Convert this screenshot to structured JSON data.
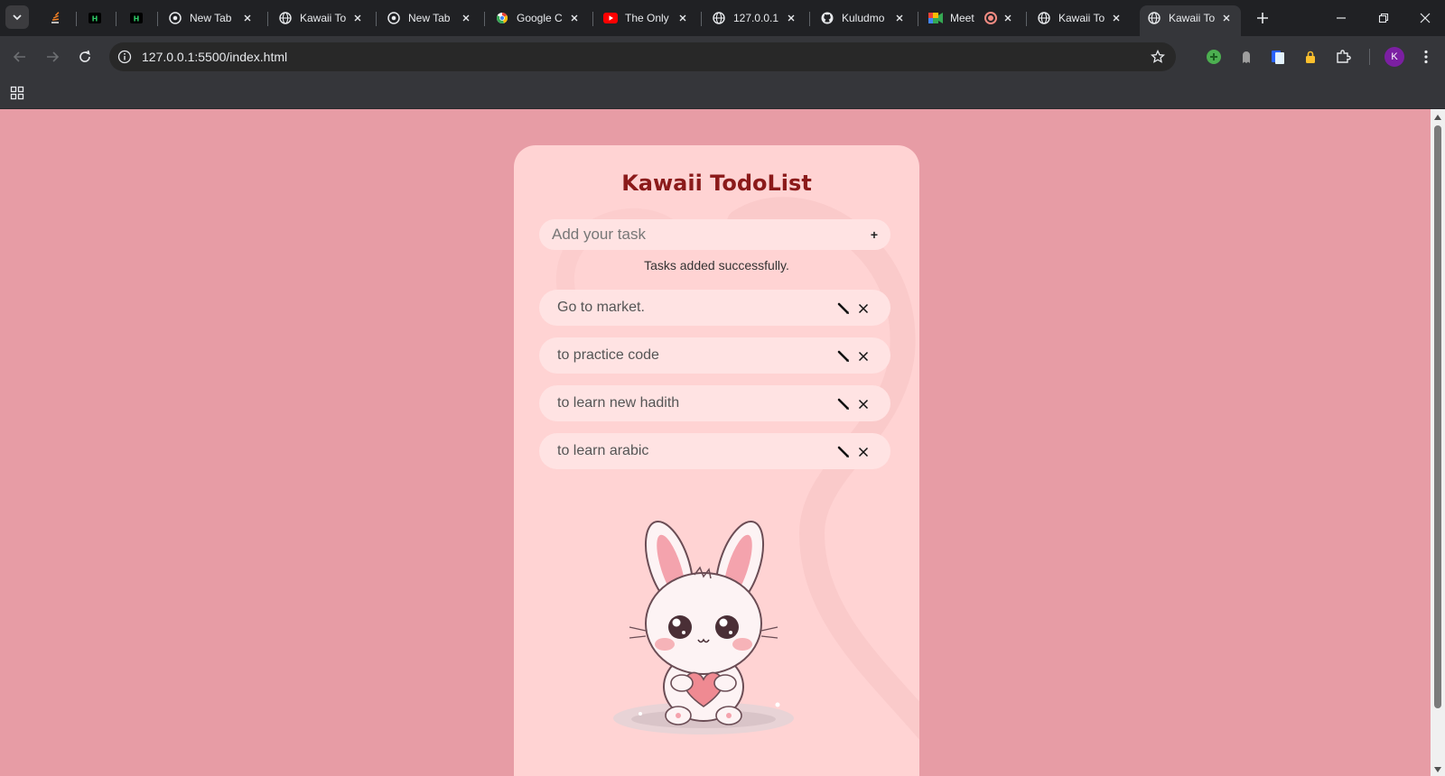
{
  "browser": {
    "tabs": [
      {
        "title": "",
        "favicon": "tab-list-icon"
      },
      {
        "title": "",
        "favicon": "stackoverflow-icon"
      },
      {
        "title": "",
        "favicon": "hackerrank-icon"
      },
      {
        "title": "",
        "favicon": "hackerrank-icon"
      },
      {
        "title": "New Tab",
        "favicon": "chrome-icon"
      },
      {
        "title": "Kawaii To",
        "favicon": "globe-icon"
      },
      {
        "title": "New Tab",
        "favicon": "chrome-icon"
      },
      {
        "title": "Google C",
        "favicon": "google-icon"
      },
      {
        "title": "The Only",
        "favicon": "youtube-icon"
      },
      {
        "title": "127.0.0.1",
        "favicon": "globe-icon"
      },
      {
        "title": "Kuludmo",
        "favicon": "github-icon"
      },
      {
        "title": "Meet",
        "favicon": "meet-icon"
      },
      {
        "title": "Kawaii To",
        "favicon": "globe-icon"
      },
      {
        "title": "Kawaii To",
        "favicon": "globe-icon",
        "active": true
      }
    ],
    "url": "127.0.0.1:5500/index.html",
    "profile_initial": "K",
    "colors": {
      "frame": "#202124",
      "toolbar": "#35363a",
      "avatar": "#7b1fa2"
    }
  },
  "page": {
    "title": "Kawaii TodoList",
    "input_placeholder": "Add your task",
    "add_label": "+",
    "status_message": "Tasks added successfully.",
    "tasks": [
      {
        "text": "Go to market."
      },
      {
        "text": "to practice code"
      },
      {
        "text": "to learn new hadith"
      },
      {
        "text": "to learn arabic"
      }
    ],
    "colors": {
      "background": "#e79ca5",
      "card": "#ffd3d3",
      "title": "#8b1a1a",
      "pill": "#ffe3e3"
    }
  }
}
